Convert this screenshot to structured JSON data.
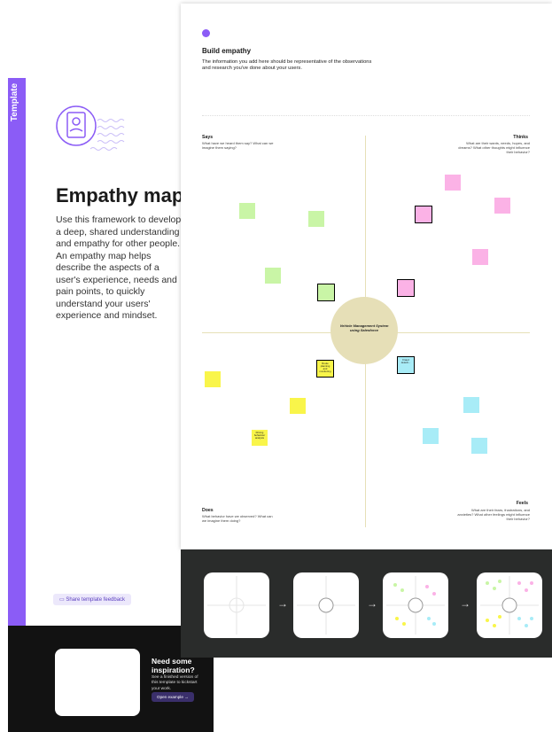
{
  "left_panel": {
    "vertical_label": "Template",
    "title": "Empathy map",
    "description": "Use this framework to develop a deep, shared understanding and empathy for other people. An empathy map helps describe the aspects of a user's experience, needs and pain points, to quickly understand your users' experience and mindset.",
    "feedback_button": "Share template feedback",
    "inspiration": {
      "title": "Need some inspiration?",
      "text": "See a finished version of this template to kickstart your work.",
      "button": "Open example"
    }
  },
  "board": {
    "title": "Build empathy",
    "subtitle": "The information you add here should be representative of the observations and research you've done about your users.",
    "center": "Vehicle Management System using Salesforce",
    "quadrants": {
      "says": {
        "label": "Says",
        "text": "What have we heard them say? What can we imagine them saying?"
      },
      "thinks": {
        "label": "Thinks",
        "text": "What are their wants, needs, hopes, and dreams? What other thoughts might influence their behavior?"
      },
      "does": {
        "label": "Does",
        "text": "What behavior have we observed? What can we imagine them doing?"
      },
      "feels": {
        "label": "Feels",
        "text": "What are their fears, frustrations, and anxieties? What other feelings might influence their behavior?"
      }
    },
    "notes": [
      {
        "color": "#c9f5a6",
        "text": ""
      },
      {
        "color": "#c9f5a6",
        "text": ""
      },
      {
        "color": "#c9f5a6",
        "text": ""
      },
      {
        "color": "#c9f5a6",
        "text": ""
      },
      {
        "color": "#fbb2e6",
        "text": ""
      },
      {
        "color": "#fbb2e6",
        "text": ""
      },
      {
        "color": "#fbb2e6",
        "text": ""
      },
      {
        "color": "#fbb2e6",
        "text": ""
      },
      {
        "color": "#fbb2e6",
        "text": ""
      },
      {
        "color": "#f9f54a",
        "text": ""
      },
      {
        "color": "#f9f54a",
        "text": "Route planning and monitoring"
      },
      {
        "color": "#f9f54a",
        "text": ""
      },
      {
        "color": "#f9f54a",
        "text": "Driving behaviour analysis"
      },
      {
        "color": "#a8ecf7",
        "text": "Fraud detecti..."
      },
      {
        "color": "#a8ecf7",
        "text": ""
      },
      {
        "color": "#a8ecf7",
        "text": ""
      },
      {
        "color": "#a8ecf7",
        "text": ""
      }
    ]
  },
  "colors": {
    "accent": "#8b5cf6",
    "dark": "#121212",
    "strip": "#2a2c2b",
    "circle": "#e6dfb7"
  }
}
